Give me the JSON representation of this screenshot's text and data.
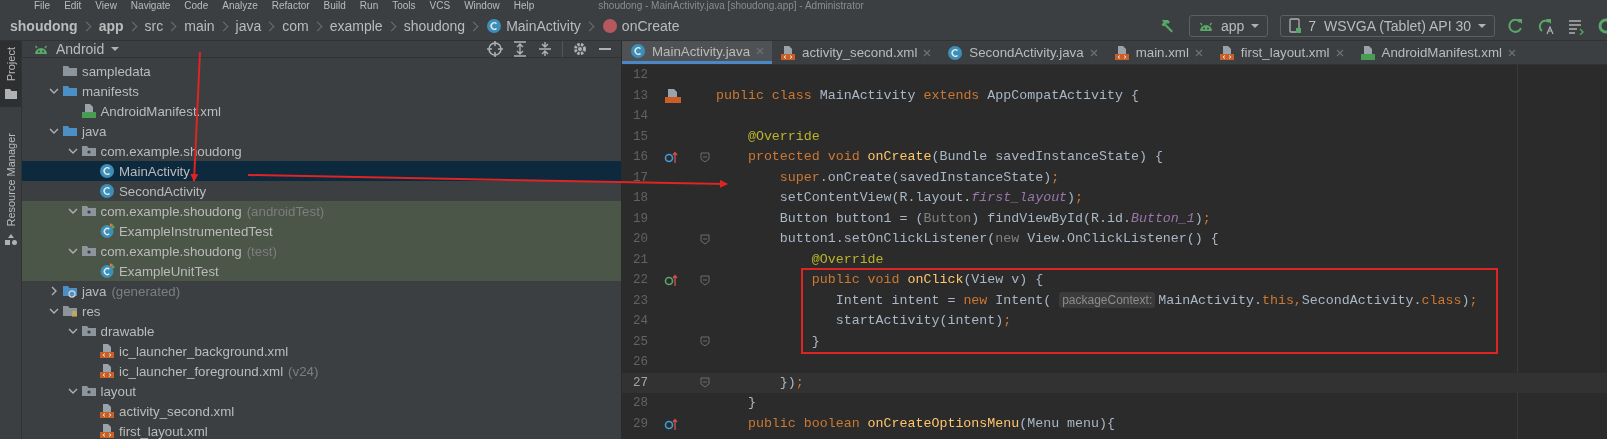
{
  "menu": [
    "File",
    "Edit",
    "View",
    "Navigate",
    "Code",
    "Analyze",
    "Refactor",
    "Build",
    "Run",
    "Tools",
    "VCS",
    "Window",
    "Help"
  ],
  "window_title": "shoudong - MainActivity.java [shoudong.app] - Administrator",
  "breadcrumb": [
    {
      "label": "shoudong",
      "kind": "module"
    },
    {
      "label": "app",
      "kind": "module"
    },
    {
      "label": "src",
      "kind": "dir"
    },
    {
      "label": "main",
      "kind": "dir"
    },
    {
      "label": "java",
      "kind": "dir"
    },
    {
      "label": "com",
      "kind": "dir"
    },
    {
      "label": "example",
      "kind": "dir"
    },
    {
      "label": "shoudong",
      "kind": "dir"
    },
    {
      "label": "MainActivity",
      "kind": "class"
    },
    {
      "label": "onCreate",
      "kind": "method"
    }
  ],
  "toolbar": {
    "config": "app",
    "device": "7  WSVGA (Tablet) API 30"
  },
  "side_stripe": [
    {
      "label": "Project",
      "selected": true
    },
    {
      "label": "Resource Manager",
      "selected": false
    }
  ],
  "project": {
    "view": "Android",
    "tree": [
      {
        "label": "sampledata",
        "kind": "folder",
        "selected": false,
        "shaded": false
      },
      {
        "label": "manifests",
        "kind": "source-folder",
        "expanded": true,
        "selected": false,
        "shaded": false,
        "children": [
          {
            "label": "AndroidManifest.xml",
            "kind": "manifest",
            "selected": false,
            "shaded": false
          }
        ]
      },
      {
        "label": "java",
        "kind": "source-folder",
        "expanded": true,
        "selected": false,
        "shaded": false,
        "children": [
          {
            "label": "com.example.shoudong",
            "kind": "package",
            "expanded": true,
            "selected": false,
            "shaded": false,
            "children": [
              {
                "label": "MainActivity",
                "kind": "class",
                "selected": true,
                "shaded": false
              },
              {
                "label": "SecondActivity",
                "kind": "class",
                "selected": false,
                "shaded": false
              }
            ]
          },
          {
            "label": "com.example.shoudong",
            "note": "(androidTest)",
            "kind": "package",
            "expanded": true,
            "selected": false,
            "shaded": true,
            "children": [
              {
                "label": "ExampleInstrumentedTest",
                "kind": "test-class",
                "selected": false,
                "shaded": true
              }
            ]
          },
          {
            "label": "com.example.shoudong",
            "note": "(test)",
            "kind": "package",
            "expanded": true,
            "selected": false,
            "shaded": true,
            "children": [
              {
                "label": "ExampleUnitTest",
                "kind": "test-class",
                "selected": false,
                "shaded": true
              }
            ]
          }
        ]
      },
      {
        "label": "java",
        "note": "(generated)",
        "kind": "generated-folder",
        "expanded": false,
        "selected": false,
        "shaded": false
      },
      {
        "label": "res",
        "kind": "res-folder",
        "expanded": true,
        "selected": false,
        "shaded": false,
        "children": [
          {
            "label": "drawable",
            "kind": "package",
            "expanded": true,
            "selected": false,
            "shaded": false,
            "children": [
              {
                "label": "ic_launcher_background.xml",
                "kind": "xml",
                "selected": false,
                "shaded": false
              },
              {
                "label": "ic_launcher_foreground.xml",
                "note": "(v24)",
                "kind": "xml",
                "selected": false,
                "shaded": false
              }
            ]
          },
          {
            "label": "layout",
            "kind": "package",
            "expanded": true,
            "selected": false,
            "shaded": false,
            "children": [
              {
                "label": "activity_second.xml",
                "kind": "xml",
                "selected": false,
                "shaded": false
              },
              {
                "label": "first_layout.xml",
                "kind": "xml",
                "selected": false,
                "shaded": false
              }
            ]
          }
        ]
      }
    ]
  },
  "tabs": [
    {
      "label": "MainActivity.java",
      "kind": "class",
      "selected": true
    },
    {
      "label": "activity_second.xml",
      "kind": "xml",
      "selected": false
    },
    {
      "label": "SecondActivity.java",
      "kind": "class",
      "selected": false
    },
    {
      "label": "main.xml",
      "kind": "xml",
      "selected": false
    },
    {
      "label": "first_layout.xml",
      "kind": "xml",
      "selected": false
    },
    {
      "label": "AndroidManifest.xml",
      "kind": "manifest",
      "selected": false
    }
  ],
  "code": {
    "lines": [
      {
        "kind": "line",
        "number": "12",
        "current": false
      },
      {
        "kind": "line",
        "number": "13",
        "gutter": {
          "kind": "layout"
        },
        "current": false,
        "segments": [
          {
            "kind": "kw",
            "text": "public class"
          },
          {
            "kind": "plain",
            "text": " MainActivity "
          },
          {
            "kind": "kw",
            "text": "extends"
          },
          {
            "kind": "plain",
            "text": " AppCompatActivity {"
          }
        ]
      },
      {
        "kind": "line",
        "number": "14",
        "current": false
      },
      {
        "kind": "line",
        "number": "15",
        "current": false,
        "segments": [
          {
            "kind": "ann",
            "text": "    @Override"
          }
        ]
      },
      {
        "kind": "line",
        "number": "16",
        "gutter": {
          "kind": "override"
        },
        "fold": true,
        "current": false,
        "segments": [
          {
            "kind": "kw",
            "text": "    protected void "
          },
          {
            "kind": "method",
            "text": "onCreate"
          },
          {
            "kind": "plain",
            "text": "(Bundle savedInstanceState) {"
          }
        ]
      },
      {
        "kind": "line",
        "number": "17",
        "current": false,
        "segments": [
          {
            "kind": "kw",
            "text": "        super"
          },
          {
            "kind": "plain",
            "text": ".onCreate(savedInstanceState)"
          },
          {
            "kind": "kw",
            "text": ";"
          }
        ]
      },
      {
        "kind": "line",
        "number": "18",
        "current": false,
        "segments": [
          {
            "kind": "plain",
            "text": "        setContentView(R.layout."
          },
          {
            "kind": "field",
            "text": "first_layout"
          },
          {
            "kind": "plain",
            "text": ")"
          },
          {
            "kind": "kw",
            "text": ";"
          }
        ]
      },
      {
        "kind": "line",
        "number": "19",
        "current": false,
        "segments": [
          {
            "kind": "plain",
            "text": "        Button button1 = ("
          },
          {
            "kind": "gray",
            "text": "Button"
          },
          {
            "kind": "plain",
            "text": ") findViewById(R.id."
          },
          {
            "kind": "field",
            "text": "Button_1"
          },
          {
            "kind": "plain",
            "text": ")"
          },
          {
            "kind": "kw",
            "text": ";"
          }
        ]
      },
      {
        "kind": "line",
        "number": "20",
        "fold": true,
        "current": false,
        "segments": [
          {
            "kind": "plain",
            "text": "        button1.setOnClickListener("
          },
          {
            "kind": "gray",
            "text": "new"
          },
          {
            "kind": "plain",
            "text": " View.OnClickListener() {"
          }
        ]
      },
      {
        "kind": "line",
        "number": "21",
        "current": false,
        "segments": [
          {
            "kind": "ann",
            "text": "            @Override"
          }
        ]
      },
      {
        "kind": "boxed-group",
        "lines": [
          {
            "kind": "line",
            "number": "22",
            "gutter": {
              "kind": "implement"
            },
            "fold": true,
            "current": false,
            "segments": [
              {
                "kind": "kw",
                "text": "            public void "
              },
              {
                "kind": "method",
                "text": "onClick"
              },
              {
                "kind": "plain",
                "text": "(View v) {"
              }
            ]
          },
          {
            "kind": "line",
            "number": "23",
            "current": false,
            "segments": [
              {
                "kind": "plain",
                "text": "               Intent intent = "
              },
              {
                "kind": "kw",
                "text": "new"
              },
              {
                "kind": "plain",
                "text": " Intent( "
              },
              {
                "kind": "hint",
                "text": "packageContext:"
              },
              {
                "kind": "plain",
                "text": "MainActivity."
              },
              {
                "kind": "kw",
                "text": "this,"
              },
              {
                "kind": "plain",
                "text": "SecondActivity."
              },
              {
                "kind": "kw",
                "text": "class"
              },
              {
                "kind": "plain",
                "text": ")"
              },
              {
                "kind": "kw",
                "text": ";"
              }
            ]
          },
          {
            "kind": "line",
            "number": "24",
            "current": false,
            "segments": [
              {
                "kind": "plain",
                "text": "               startActivity(intent)"
              },
              {
                "kind": "kw",
                "text": ";"
              }
            ]
          },
          {
            "kind": "line",
            "number": "25",
            "fold": true,
            "current": false,
            "segments": [
              {
                "kind": "plain",
                "text": "            }"
              }
            ]
          }
        ]
      },
      {
        "kind": "line",
        "number": "26",
        "current": false
      },
      {
        "kind": "line",
        "number": "27",
        "fold": true,
        "current": true,
        "segments": [
          {
            "kind": "plain",
            "text": "        })"
          },
          {
            "kind": "kw",
            "text": ";"
          }
        ]
      },
      {
        "kind": "line",
        "number": "28",
        "current": false,
        "segments": [
          {
            "kind": "plain",
            "text": "    }"
          }
        ]
      },
      {
        "kind": "line",
        "number": "29",
        "gutter": {
          "kind": "override"
        },
        "current": false,
        "segments": [
          {
            "kind": "kw",
            "text": "    public boolean "
          },
          {
            "kind": "method",
            "text": "onCreateOptionsMenu"
          },
          {
            "kind": "plain",
            "text": "(Menu menu){"
          }
        ]
      }
    ]
  }
}
